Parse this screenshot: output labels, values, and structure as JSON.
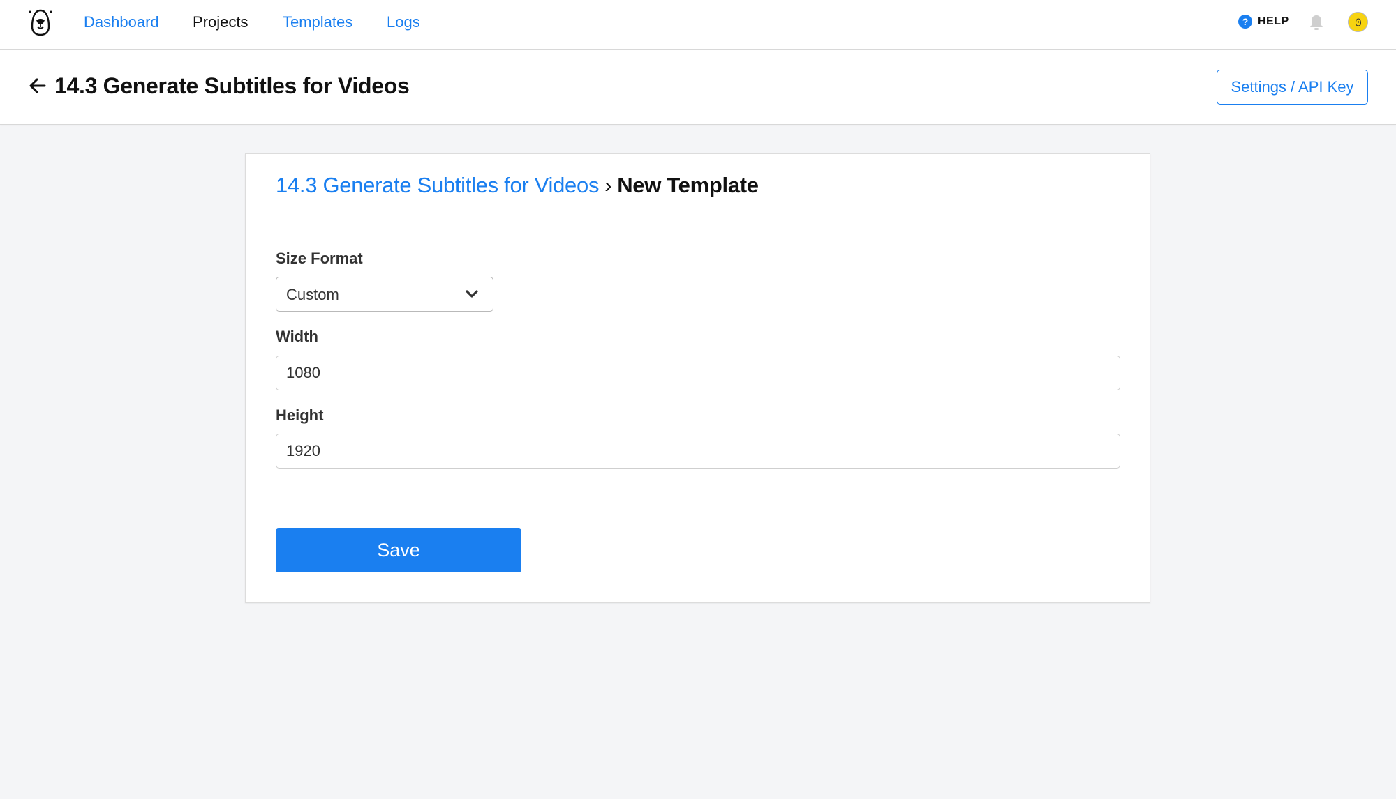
{
  "nav": {
    "logo": "bear-logo-icon",
    "items": [
      {
        "label": "Dashboard",
        "active": false
      },
      {
        "label": "Projects",
        "active": true
      },
      {
        "label": "Templates",
        "active": false
      },
      {
        "label": "Logs",
        "active": false
      }
    ],
    "help_label": "HELP",
    "help_icon": "?",
    "colors": {
      "accent": "#1a7ff0",
      "avatar": "#f7d311"
    }
  },
  "page_header": {
    "title": "14.3 Generate Subtitles for Videos",
    "settings_label": "Settings / API Key"
  },
  "card": {
    "breadcrumb": {
      "parent": "14.3 Generate Subtitles for Videos",
      "separator": "›",
      "current": "New Template"
    },
    "form": {
      "size_format": {
        "label": "Size Format",
        "value": "Custom"
      },
      "width": {
        "label": "Width",
        "value": "1080"
      },
      "height": {
        "label": "Height",
        "value": "1920"
      }
    },
    "save_label": "Save"
  }
}
